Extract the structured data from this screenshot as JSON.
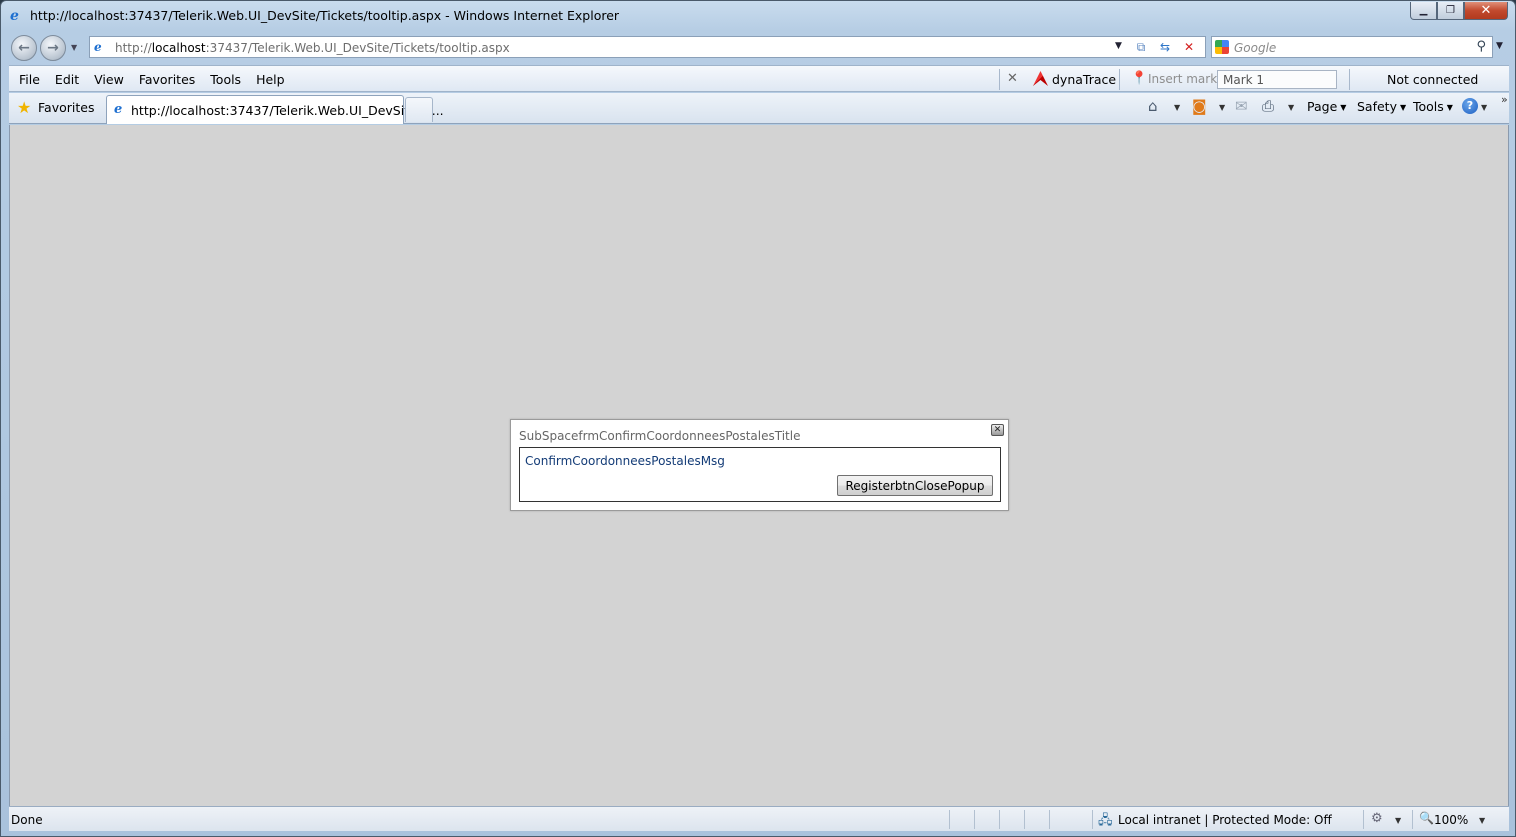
{
  "window": {
    "title": "http://localhost:37437/Telerik.Web.UI_DevSite/Tickets/tooltip.aspx - Windows Internet Explorer"
  },
  "address_bar": {
    "url_prefix": "http://",
    "url_host": "localhost",
    "url_rest": ":37437/Telerik.Web.UI_DevSite/Tickets/tooltip.aspx"
  },
  "search": {
    "placeholder": "Google"
  },
  "menu": {
    "items": [
      "File",
      "Edit",
      "View",
      "Favorites",
      "Tools",
      "Help"
    ]
  },
  "toolbar": {
    "dynatrace_label": "dynaTrace",
    "insert_mark_label": "Insert mark",
    "mark_input_value": "Mark 1",
    "connection_status": "Not connected"
  },
  "favorites": {
    "label": "Favorites"
  },
  "tabs": [
    {
      "label": "http://localhost:37437/Telerik.Web.UI_DevSite/Ti..."
    }
  ],
  "command_bar": {
    "page_label": "Page",
    "safety_label": "Safety",
    "tools_label": "Tools"
  },
  "popup": {
    "title": "SubSpacefrmConfirmCoordonneesPostalesTitle",
    "message": "ConfirmCoordonneesPostalesMsg",
    "button_label": "RegisterbtnClosePopup"
  },
  "status_bar": {
    "status_text": "Done",
    "zone_text": "Local intranet | Protected Mode: Off",
    "zoom_text": "100%"
  }
}
